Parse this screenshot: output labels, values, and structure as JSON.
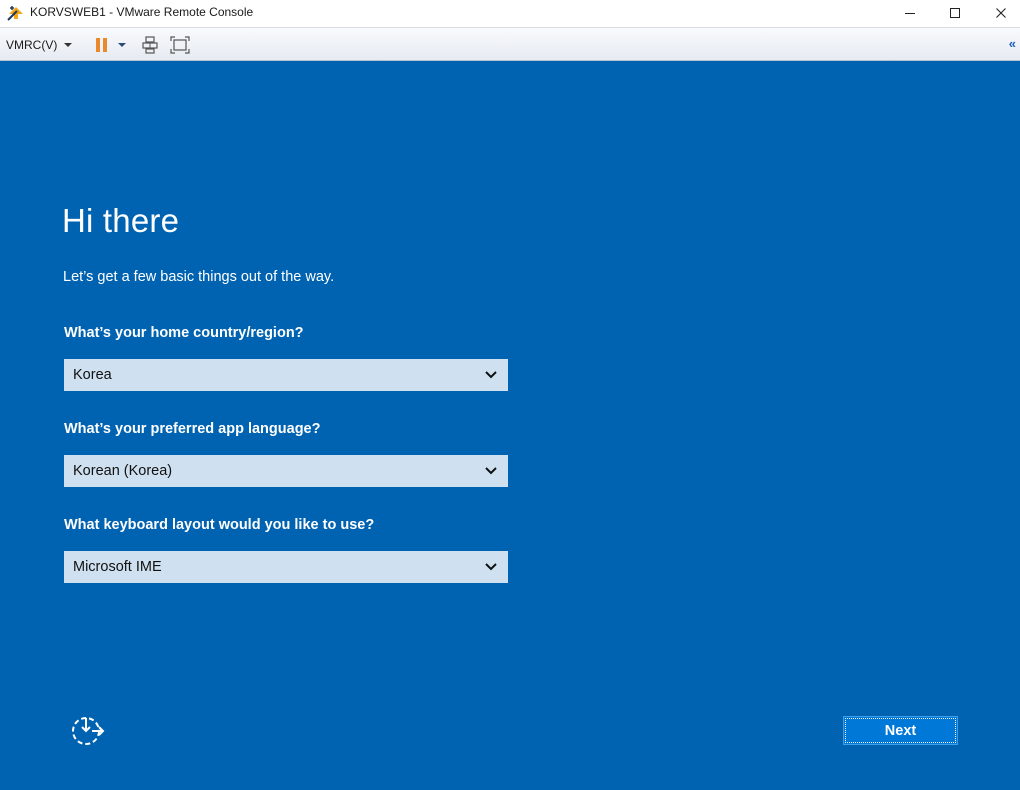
{
  "window": {
    "title": "KORVSWEB1 - VMware Remote Console",
    "app_icon": "vmrc-app-icon",
    "controls": [
      "minimize-icon",
      "maximize-icon",
      "close-icon"
    ]
  },
  "toolbar": {
    "menu_label": "VMRC(V)",
    "pause_icon": "pause-icon",
    "send_ctrl_alt_del_icon": "ctrl-alt-del-icon",
    "fullscreen_icon": "fullscreen-icon",
    "collapse_label": "«"
  },
  "setup": {
    "title": "Hi there",
    "subtitle": "Let’s get a few basic things out of the way.",
    "questions": [
      {
        "label": "What’s your home country/region?",
        "value": "Korea"
      },
      {
        "label": "What’s your preferred app language?",
        "value": "Korean (Korea)"
      },
      {
        "label": "What keyboard layout would you like to use?",
        "value": "Microsoft IME"
      }
    ],
    "next_label": "Next",
    "accessibility_icon": "ease-of-access-icon"
  },
  "colors": {
    "background": "#0063b1",
    "dropdown": "#cfe0f0",
    "button": "#0078d7",
    "pause_accent": "#e8892c"
  }
}
